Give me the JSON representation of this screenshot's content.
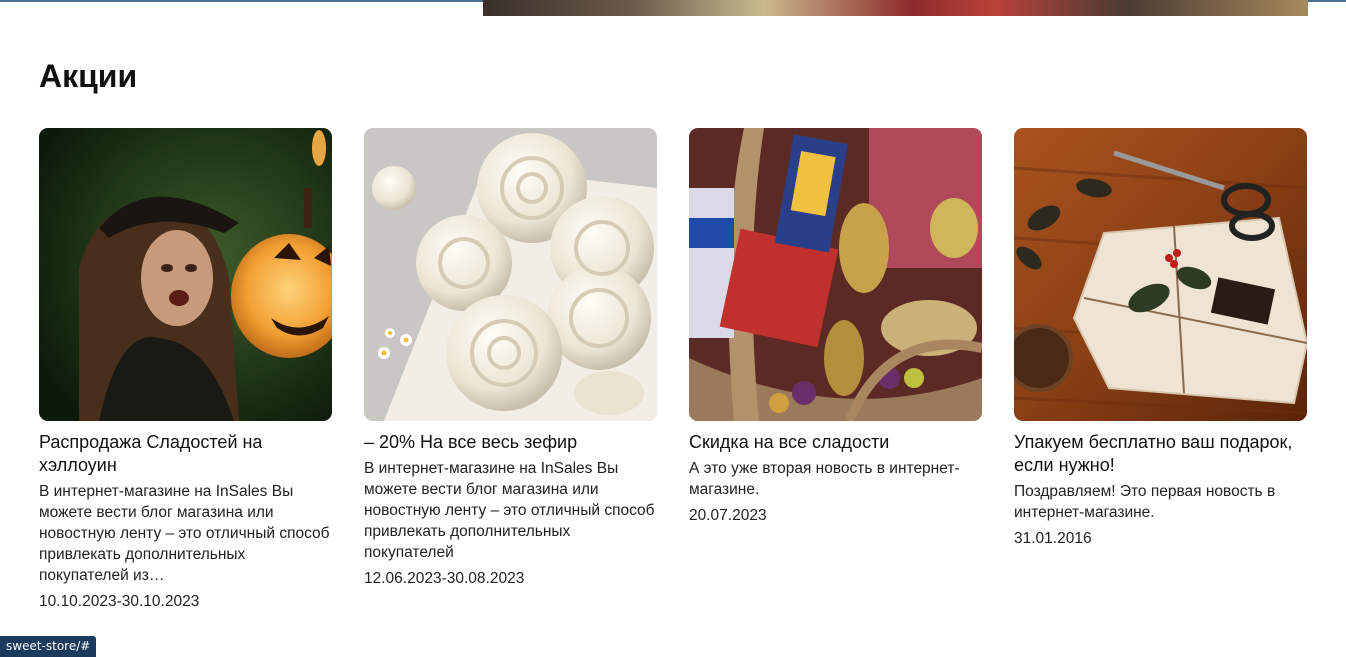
{
  "section": {
    "title": "Акции"
  },
  "cards": [
    {
      "image": "halloween-woman-pumpkin-image",
      "title": "Распродажа Сладостей на хэллоуин",
      "description": "В интернет-магазине на InSales Вы можете вести блог магазина или новостную ленту – это отличный способ привлекать дополнительных покупателей из…",
      "date": "10.10.2023-30.10.2023"
    },
    {
      "image": "marshmallow-zefir-image",
      "title": "– 20% На все весь зефир",
      "description": "В интернет-магазине на InSales Вы можете вести блог магазина или новостную ленту – это отличный способ привлекать дополнительных покупателей",
      "date": "12.06.2023-30.08.2023"
    },
    {
      "image": "sweets-basket-image",
      "title": "Скидка на все сладости",
      "description": "А это уже вторая новость в интернет-магазине.",
      "date": "20.07.2023"
    },
    {
      "image": "gift-box-image",
      "title": "Упакуем бесплатно ваш подарок, если нужно!",
      "description": "Поздравляем! Это первая новость в интернет-магазине.",
      "date": "31.01.2016"
    }
  ],
  "status_bar": {
    "url": "sweet-store/#"
  }
}
